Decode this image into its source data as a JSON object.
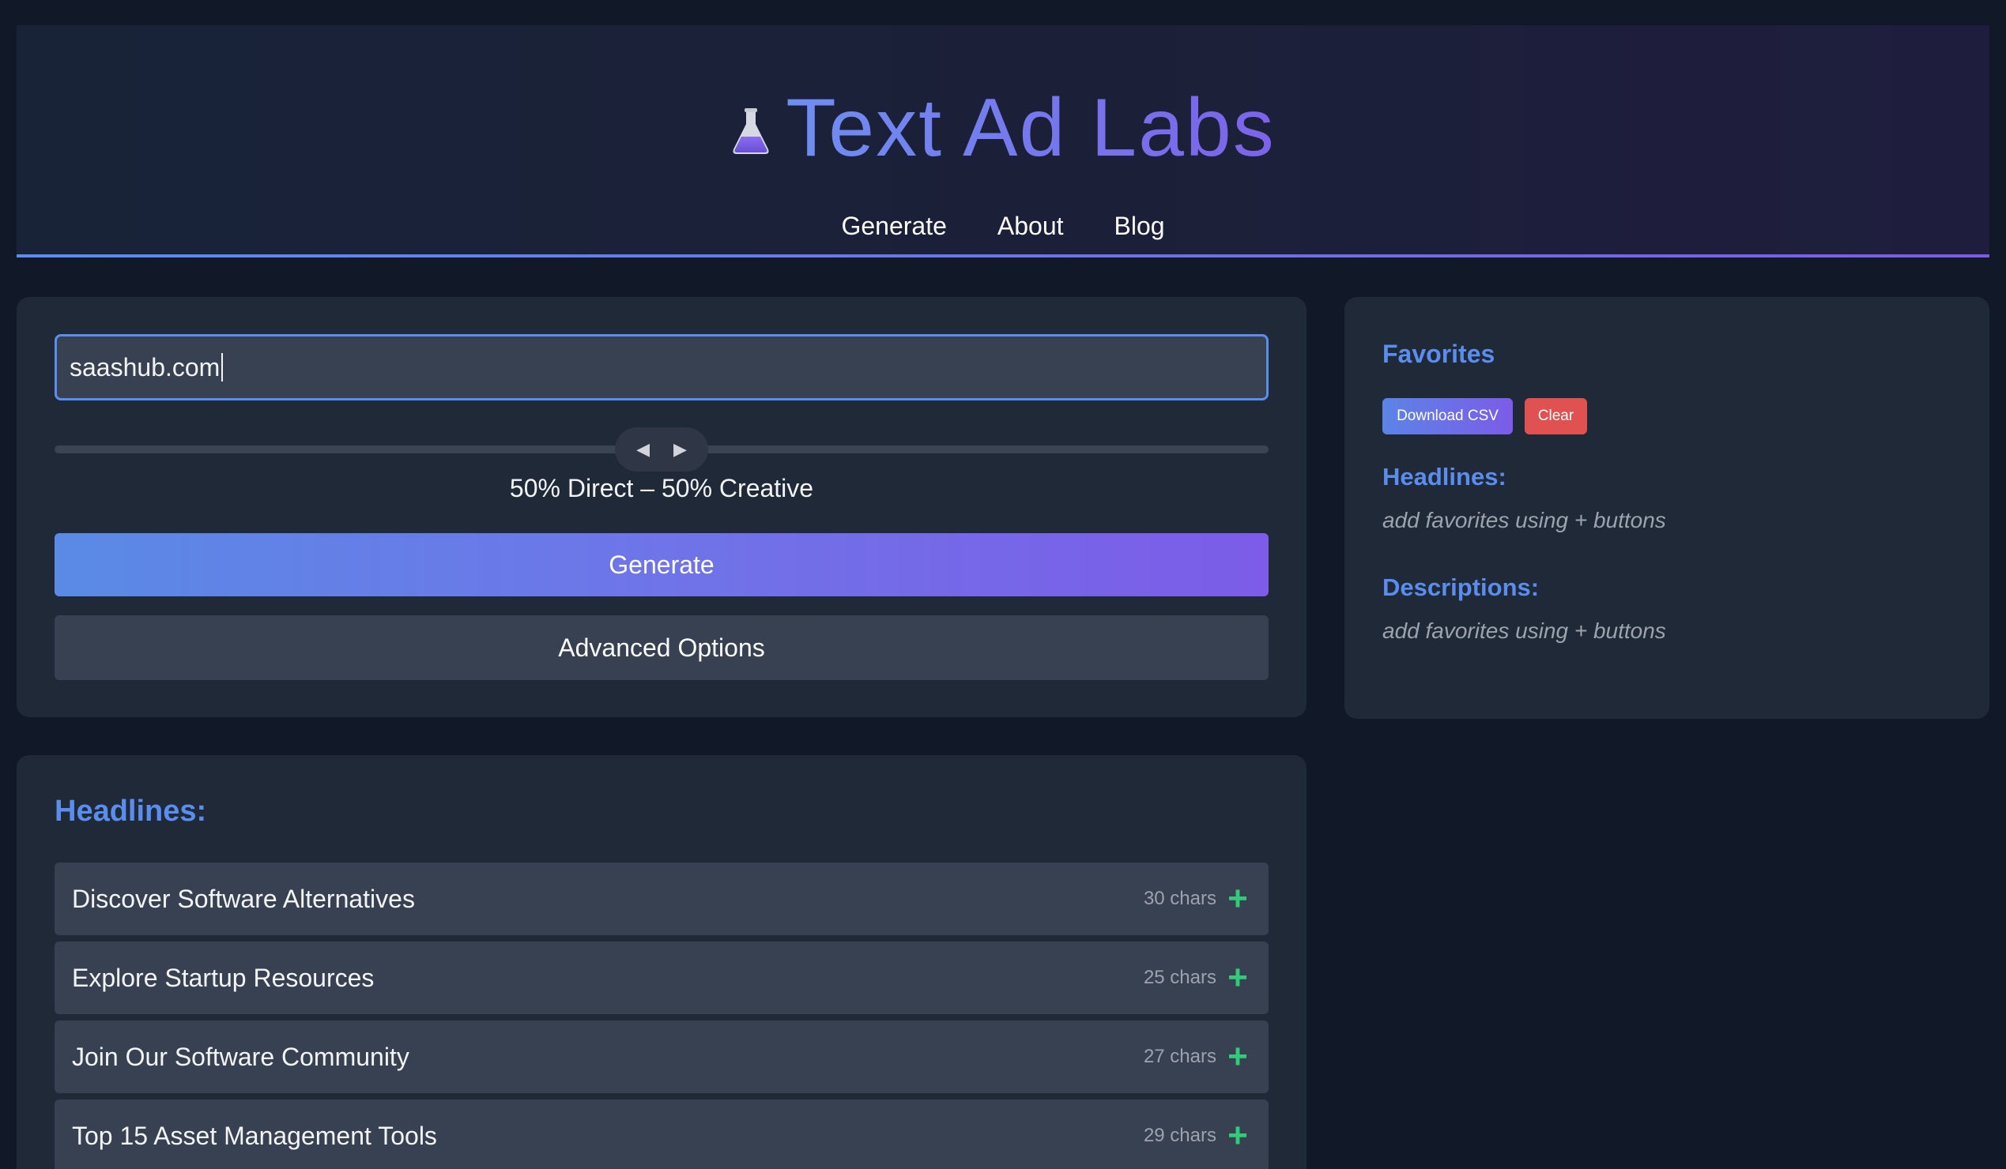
{
  "header": {
    "title": "Text Ad Labs",
    "icon": "flask-icon",
    "nav": [
      {
        "label": "Generate"
      },
      {
        "label": "About"
      },
      {
        "label": "Blog"
      }
    ]
  },
  "generator": {
    "url_value": "saashub.com",
    "slider": {
      "direct_percent": 50,
      "label": "50% Direct – 50% Creative"
    },
    "generate_label": "Generate",
    "advanced_label": "Advanced Options"
  },
  "favorites": {
    "title": "Favorites",
    "download_label": "Download CSV",
    "clear_label": "Clear",
    "headlines_label": "Headlines:",
    "headlines_empty": "add favorites using + buttons",
    "descriptions_label": "Descriptions:",
    "descriptions_empty": "add favorites using + buttons"
  },
  "headlines": {
    "title": "Headlines:",
    "items": [
      {
        "text": "Discover Software Alternatives",
        "chars": "30 chars"
      },
      {
        "text": "Explore Startup Resources",
        "chars": "25 chars"
      },
      {
        "text": "Join Our Software Community",
        "chars": "27 chars"
      },
      {
        "text": "Top 15 Asset Management Tools",
        "chars": "29 chars"
      }
    ],
    "add_symbol": "+"
  },
  "colors": {
    "background": "#111827",
    "card": "#1f2937",
    "accent_blue": "#5b8def",
    "accent_purple": "#7c5ce8",
    "clear_red": "#e05252",
    "plus_green": "#34c97b"
  }
}
